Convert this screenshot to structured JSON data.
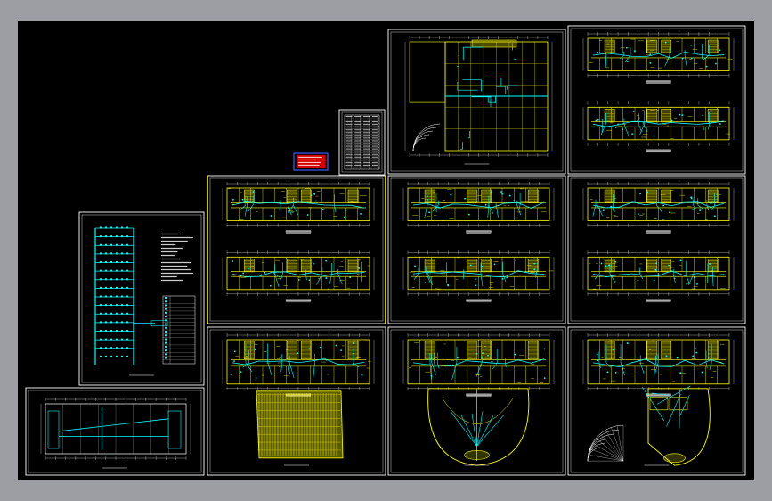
{
  "app": {
    "viewport_bg": "#000000",
    "window_bg": "#9c9ea3"
  },
  "palette": {
    "frame": "#ffffff",
    "wall": "#ffff00",
    "wire": "#00ffff",
    "hatch": "#ffff00",
    "dim": "#c8c8c8",
    "stamp_fill": "#d40000",
    "stamp_border": "#3a5cff"
  },
  "sheets": [
    {
      "id": "sheet-system-riser",
      "kind": "riser"
    },
    {
      "id": "sheet-basement",
      "kind": "single-wide"
    },
    {
      "id": "sheet-plan-a",
      "kind": "double"
    },
    {
      "id": "sheet-plan-b",
      "kind": "double"
    },
    {
      "id": "sheet-plan-c",
      "kind": "double"
    },
    {
      "id": "sheet-plan-d",
      "kind": "double"
    },
    {
      "id": "sheet-first-floor-west",
      "kind": "plaza-hatched"
    },
    {
      "id": "sheet-first-floor-center",
      "kind": "plaza-curved"
    },
    {
      "id": "sheet-first-floor-east",
      "kind": "plaza-round"
    },
    {
      "id": "sheet-top-site",
      "kind": "site"
    },
    {
      "id": "sheet-legend-table",
      "kind": "table"
    },
    {
      "id": "stamp-block",
      "kind": "stamp"
    }
  ],
  "icons": {
    "sheet_frame": "rectangle-frame",
    "title_block": "title-block-table",
    "stamp": "red-approval-stamp"
  }
}
